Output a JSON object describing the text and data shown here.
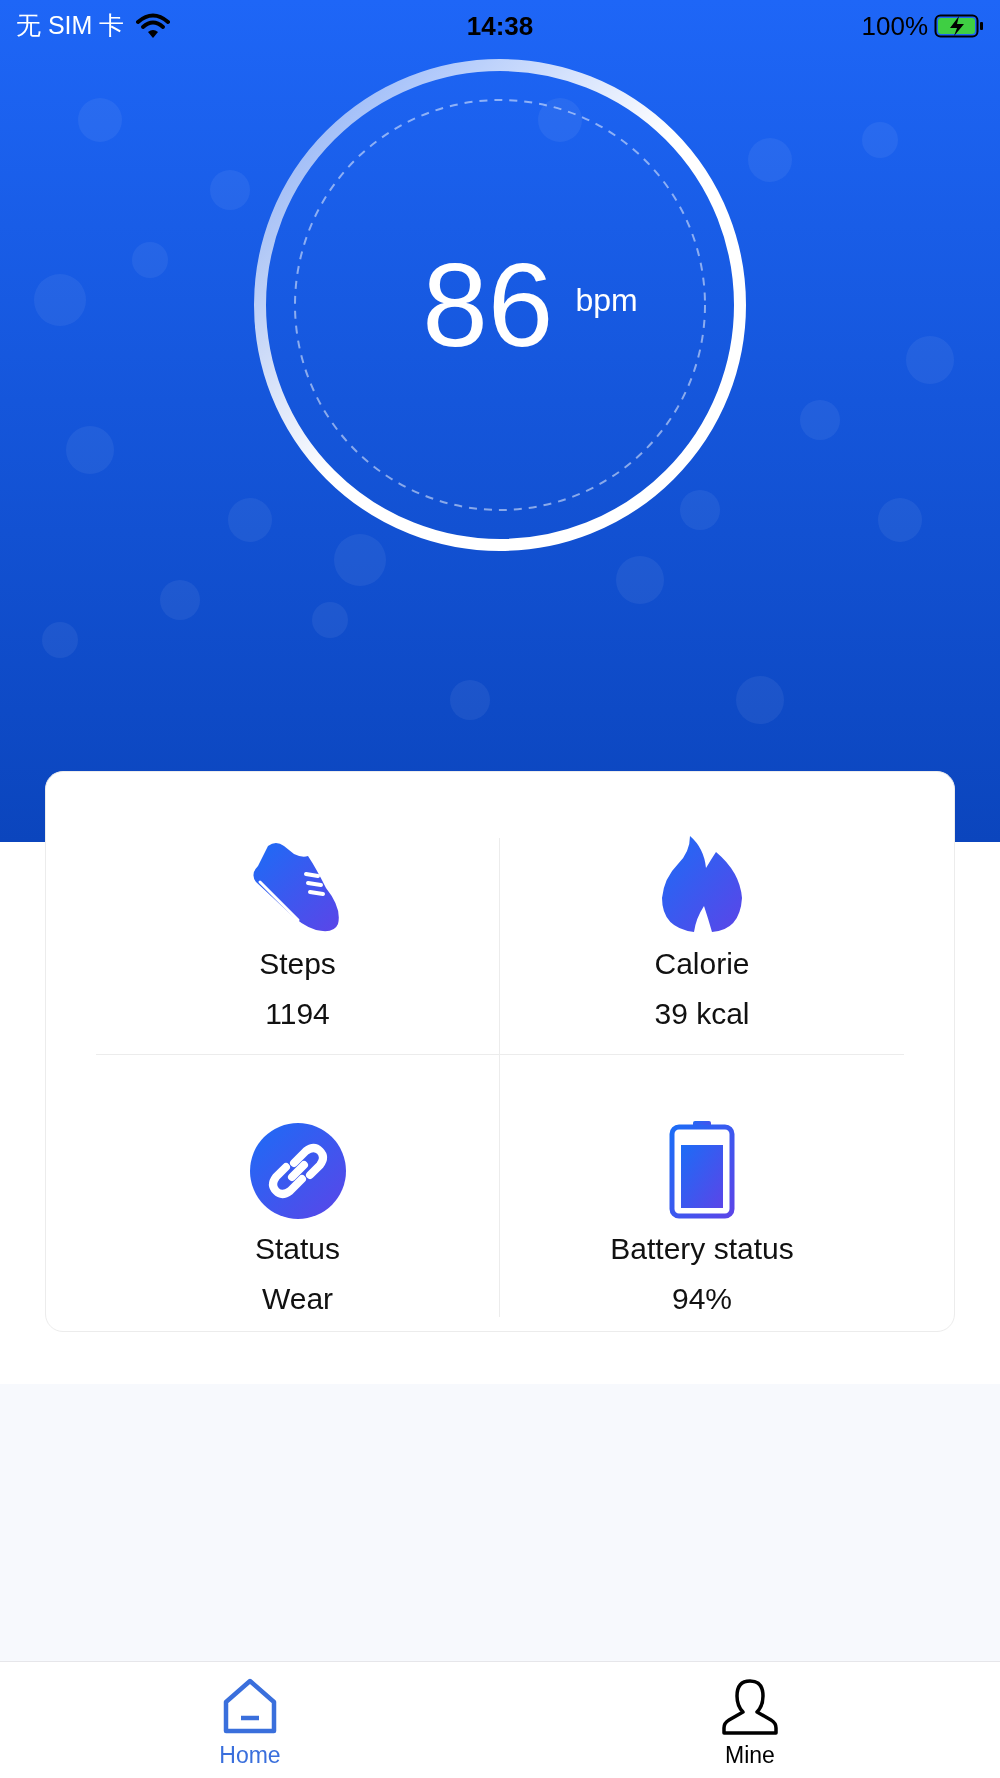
{
  "status_bar": {
    "carrier": "无 SIM 卡",
    "time": "14:38",
    "battery": "100%"
  },
  "heart_rate": {
    "value": "86",
    "unit": "bpm"
  },
  "stats": [
    {
      "kind": "steps",
      "label": "Steps",
      "value": "1194"
    },
    {
      "kind": "calorie",
      "label": "Calorie",
      "value": "39 kcal"
    },
    {
      "kind": "status",
      "label": "Status",
      "value": "Wear"
    },
    {
      "kind": "battery",
      "label": "Battery status",
      "value": "94%"
    }
  ],
  "tabs": [
    {
      "kind": "home",
      "label": "Home",
      "selected": true
    },
    {
      "kind": "mine",
      "label": "Mine",
      "selected": false
    }
  ]
}
